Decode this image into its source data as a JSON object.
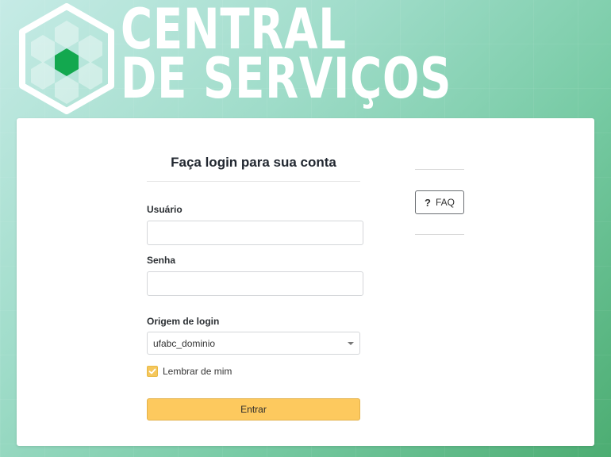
{
  "brand": {
    "line1": "CENTRAL",
    "line2": "DE SERVIÇOS",
    "logo_icon": "hexagon-logo-icon",
    "logo_accent_color": "#13a84f"
  },
  "login": {
    "title": "Faça login para sua conta",
    "username_label": "Usuário",
    "username_value": "",
    "password_label": "Senha",
    "password_value": "",
    "origin_label": "Origem de login",
    "origin_selected": "ufabc_dominio",
    "remember_label": "Lembrar de mim",
    "remember_checked": true,
    "submit_label": "Entrar"
  },
  "side": {
    "faq_label": "FAQ",
    "faq_icon": "question-icon"
  },
  "colors": {
    "accent": "#fdc95e",
    "background_start": "#c6ebe6",
    "background_end": "#4cad72"
  }
}
